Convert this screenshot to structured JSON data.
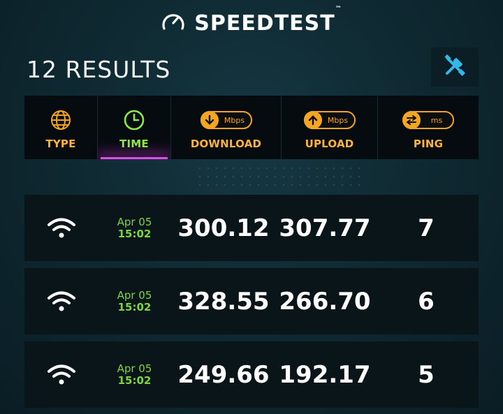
{
  "header": {
    "logo_text": "SPEEDTEST",
    "logo_tm": "™"
  },
  "title": "12 RESULTS",
  "tabs": [
    {
      "label": "TYPE",
      "icon": "globe-icon",
      "unit": ""
    },
    {
      "label": "TIME",
      "icon": "clock-icon",
      "unit": "",
      "active": true
    },
    {
      "label": "DOWNLOAD",
      "icon": "download-arrow-icon",
      "unit": "Mbps"
    },
    {
      "label": "UPLOAD",
      "icon": "upload-arrow-icon",
      "unit": "Mbps"
    },
    {
      "label": "PING",
      "icon": "ping-arrows-icon",
      "unit": "ms"
    }
  ],
  "results": [
    {
      "type": "wifi-icon",
      "date": "Apr 05",
      "time": "15:02",
      "download": "300.12",
      "upload": "307.77",
      "ping": "7"
    },
    {
      "type": "wifi-icon",
      "date": "Apr 05",
      "time": "15:02",
      "download": "328.55",
      "upload": "266.70",
      "ping": "6"
    },
    {
      "type": "wifi-icon",
      "date": "Apr 05",
      "time": "15:02",
      "download": "249.66",
      "upload": "192.17",
      "ping": "5"
    }
  ],
  "colors": {
    "accent_orange": "#f5a524",
    "accent_green": "#7cd63f",
    "active_underline": "#d84ee6",
    "tools_icon": "#33b8e8",
    "background": "#0f2a33"
  }
}
